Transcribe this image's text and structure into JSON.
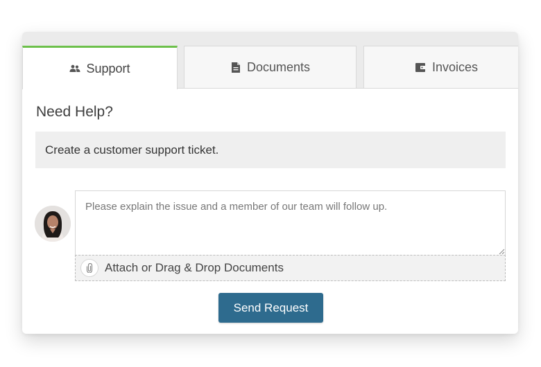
{
  "tabs": [
    {
      "label": "Support",
      "icon": "users-icon",
      "active": true
    },
    {
      "label": "Documents",
      "icon": "document-icon",
      "active": false
    },
    {
      "label": "Invoices",
      "icon": "wallet-icon",
      "active": false
    }
  ],
  "support": {
    "heading": "Need Help?",
    "banner_text": "Create a customer support ticket.",
    "message_placeholder": "Please explain the issue and a member of our team will follow up.",
    "message_value": "",
    "attach_label": "Attach or Drag & Drop Documents",
    "send_label": "Send Request"
  },
  "colors": {
    "accent_green": "#6cc04a",
    "button_blue": "#2e6b8e"
  }
}
